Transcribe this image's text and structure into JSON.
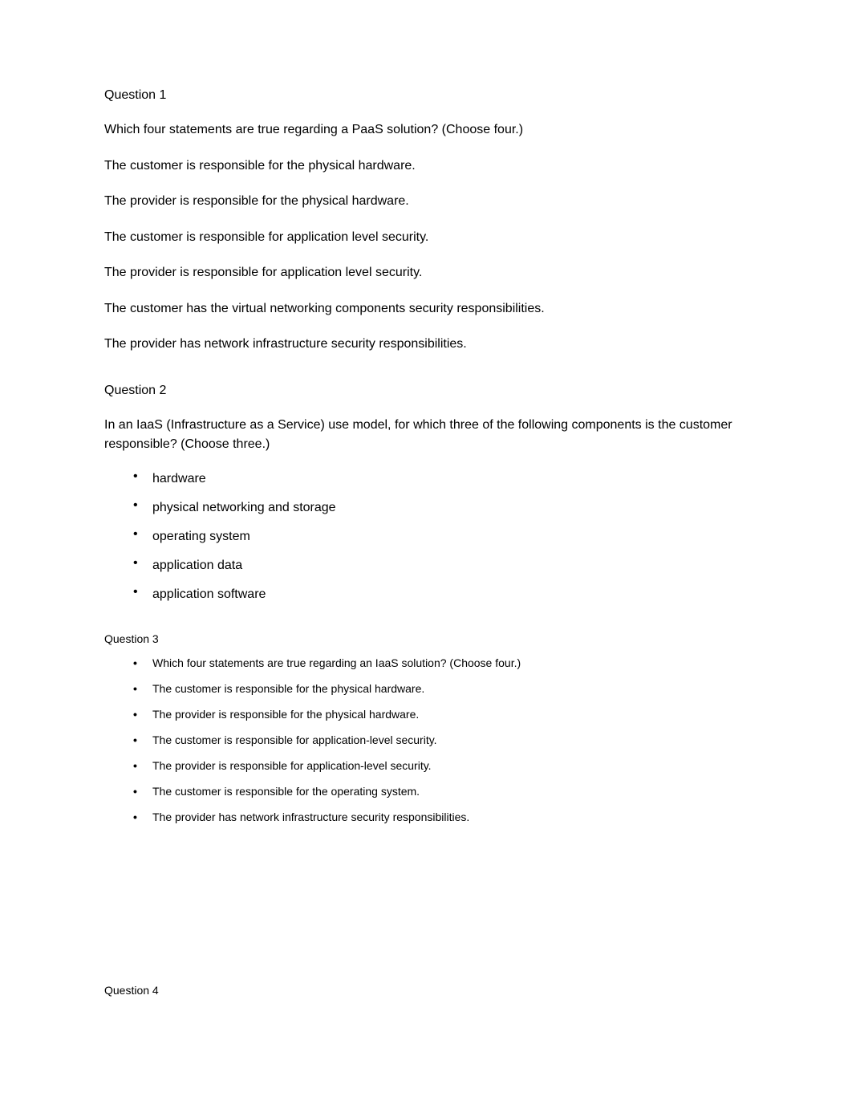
{
  "q1": {
    "title": "Question 1",
    "prompt": "Which four statements are true regarding a PaaS solution? (Choose four.)",
    "options": [
      "The customer is responsible for the physical hardware.",
      "The provider is responsible for the physical hardware.",
      "The customer is responsible for application level security.",
      "The provider is responsible for application level security.",
      "The customer has the virtual networking components security responsibilities.",
      "The provider has network infrastructure security responsibilities."
    ]
  },
  "q2": {
    "title": "Question 2",
    "prompt": "In an IaaS (Infrastructure as a Service) use model, for which three of the following components is the customer responsible? (Choose three.)",
    "options": [
      "hardware",
      "physical networking and storage",
      "operating system",
      "application data",
      "application software"
    ]
  },
  "q3": {
    "title": "Question 3",
    "options": [
      "Which four statements are true regarding an IaaS solution? (Choose four.)",
      "The customer is responsible for the physical hardware.",
      "The provider is responsible for the physical hardware.",
      "The customer is responsible for application-level security.",
      "The provider is responsible for application-level security.",
      "The customer is responsible for the operating system.",
      "The provider has network infrastructure security responsibilities."
    ]
  },
  "q4": {
    "title": "Question 4"
  }
}
